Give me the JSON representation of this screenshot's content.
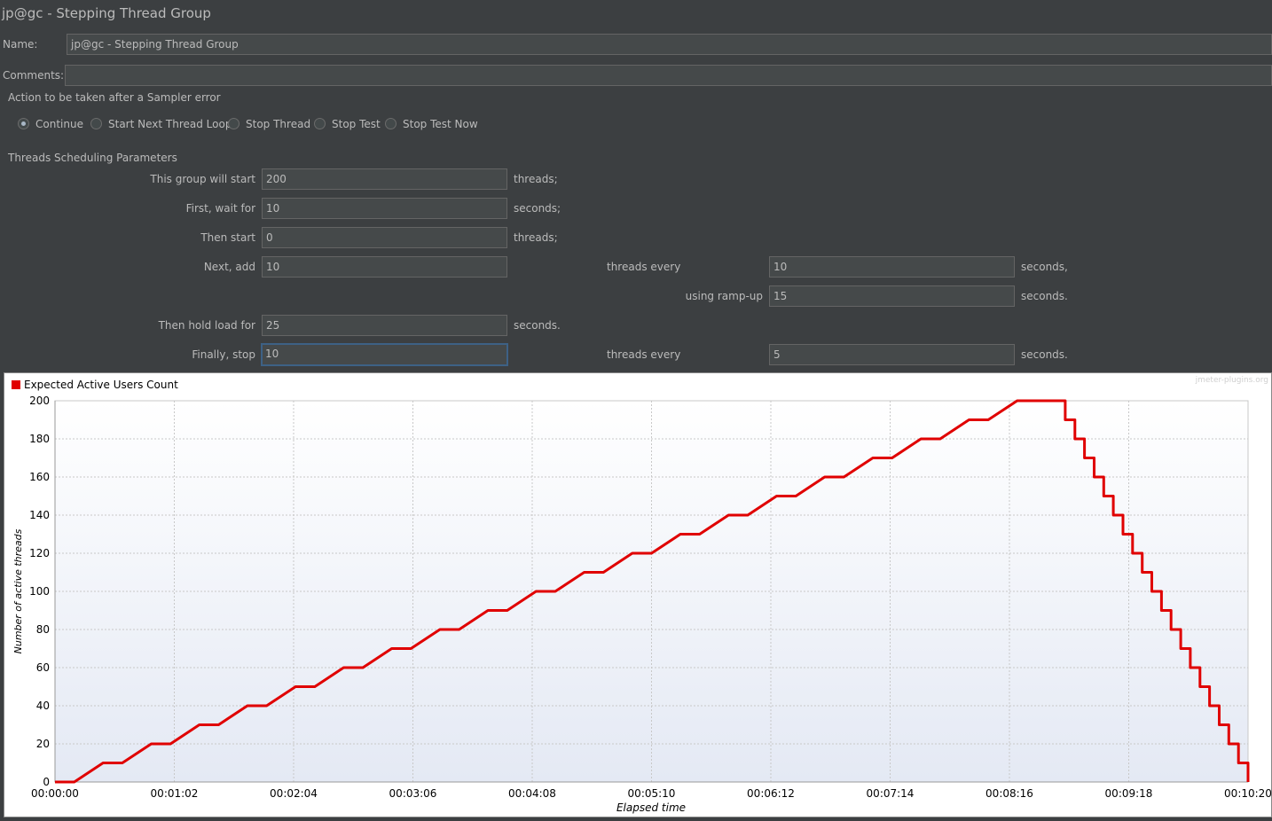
{
  "window": {
    "title": "jp@gc - Stepping Thread Group"
  },
  "name": {
    "label": "Name:",
    "value": "jp@gc - Stepping Thread Group"
  },
  "comments": {
    "label": "Comments:",
    "value": ""
  },
  "sampler_error": {
    "title": "Action to be taken after a Sampler error",
    "options": [
      {
        "label": "Continue",
        "selected": true
      },
      {
        "label": "Start Next Thread Loop",
        "selected": false
      },
      {
        "label": "Stop Thread",
        "selected": false
      },
      {
        "label": "Stop Test",
        "selected": false
      },
      {
        "label": "Stop Test Now",
        "selected": false
      }
    ]
  },
  "scheduling": {
    "title": "Threads Scheduling Parameters",
    "start_label": "This group will start",
    "start_value": "200",
    "start_unit": "threads;",
    "wait_label": "First, wait for",
    "wait_value": "10",
    "wait_unit": "seconds;",
    "then_start_label": "Then start",
    "then_start_value": "0",
    "then_start_unit": "threads;",
    "next_add_label": "Next, add",
    "next_add_value": "10",
    "next_add_every_label": "threads every",
    "next_add_every_value": "10",
    "next_add_every_unit": "seconds,",
    "rampup_label": "using ramp-up",
    "rampup_value": "15",
    "rampup_unit": "seconds.",
    "hold_label": "Then hold load for",
    "hold_value": "25",
    "hold_unit": "seconds.",
    "stop_label": "Finally, stop",
    "stop_value": "10",
    "stop_every_label": "threads every",
    "stop_every_value": "5",
    "stop_every_unit": "seconds."
  },
  "chart_data": {
    "type": "line",
    "legend": "Expected Active Users Count",
    "watermark": "jmeter-plugins.org",
    "xlabel": "Elapsed time",
    "ylabel": "Number of active threads",
    "ylim": [
      0,
      200
    ],
    "yticks": [
      "0",
      "20",
      "40",
      "60",
      "80",
      "100",
      "120",
      "140",
      "160",
      "180",
      "200"
    ],
    "xticks": [
      "00:00:00",
      "00:01:02",
      "00:02:04",
      "00:03:06",
      "00:04:08",
      "00:05:10",
      "00:06:12",
      "00:07:14",
      "00:08:16",
      "00:09:18",
      "00:10:20"
    ],
    "xlim_seconds": [
      0,
      620
    ],
    "color": "#e00000",
    "series": [
      {
        "points_seconds": [
          [
            0,
            0
          ],
          [
            10,
            0
          ],
          [
            25,
            10
          ],
          [
            35,
            10
          ],
          [
            50,
            20
          ],
          [
            60,
            20
          ],
          [
            75,
            30
          ],
          [
            85,
            30
          ],
          [
            100,
            40
          ],
          [
            110,
            40
          ],
          [
            125,
            50
          ],
          [
            135,
            50
          ],
          [
            150,
            60
          ],
          [
            160,
            60
          ],
          [
            175,
            70
          ],
          [
            185,
            70
          ],
          [
            200,
            80
          ],
          [
            210,
            80
          ],
          [
            225,
            90
          ],
          [
            235,
            90
          ],
          [
            250,
            100
          ],
          [
            260,
            100
          ],
          [
            275,
            110
          ],
          [
            285,
            110
          ],
          [
            300,
            120
          ],
          [
            310,
            120
          ],
          [
            325,
            130
          ],
          [
            335,
            130
          ],
          [
            350,
            140
          ],
          [
            360,
            140
          ],
          [
            375,
            150
          ],
          [
            385,
            150
          ],
          [
            400,
            160
          ],
          [
            410,
            160
          ],
          [
            425,
            170
          ],
          [
            435,
            170
          ],
          [
            450,
            180
          ],
          [
            460,
            180
          ],
          [
            475,
            190
          ],
          [
            485,
            190
          ],
          [
            500,
            200
          ],
          [
            525,
            200
          ],
          [
            525,
            190
          ],
          [
            530,
            190
          ],
          [
            530,
            180
          ],
          [
            535,
            180
          ],
          [
            535,
            170
          ],
          [
            540,
            170
          ],
          [
            540,
            160
          ],
          [
            545,
            160
          ],
          [
            545,
            150
          ],
          [
            550,
            150
          ],
          [
            550,
            140
          ],
          [
            555,
            140
          ],
          [
            555,
            130
          ],
          [
            560,
            130
          ],
          [
            560,
            120
          ],
          [
            565,
            120
          ],
          [
            565,
            110
          ],
          [
            570,
            110
          ],
          [
            570,
            100
          ],
          [
            575,
            100
          ],
          [
            575,
            90
          ],
          [
            580,
            90
          ],
          [
            580,
            80
          ],
          [
            585,
            80
          ],
          [
            585,
            70
          ],
          [
            590,
            70
          ],
          [
            590,
            60
          ],
          [
            595,
            60
          ],
          [
            595,
            50
          ],
          [
            600,
            50
          ],
          [
            600,
            40
          ],
          [
            605,
            40
          ],
          [
            605,
            30
          ],
          [
            610,
            30
          ],
          [
            610,
            20
          ],
          [
            615,
            20
          ],
          [
            615,
            10
          ],
          [
            620,
            10
          ],
          [
            620,
            0
          ]
        ]
      }
    ]
  }
}
